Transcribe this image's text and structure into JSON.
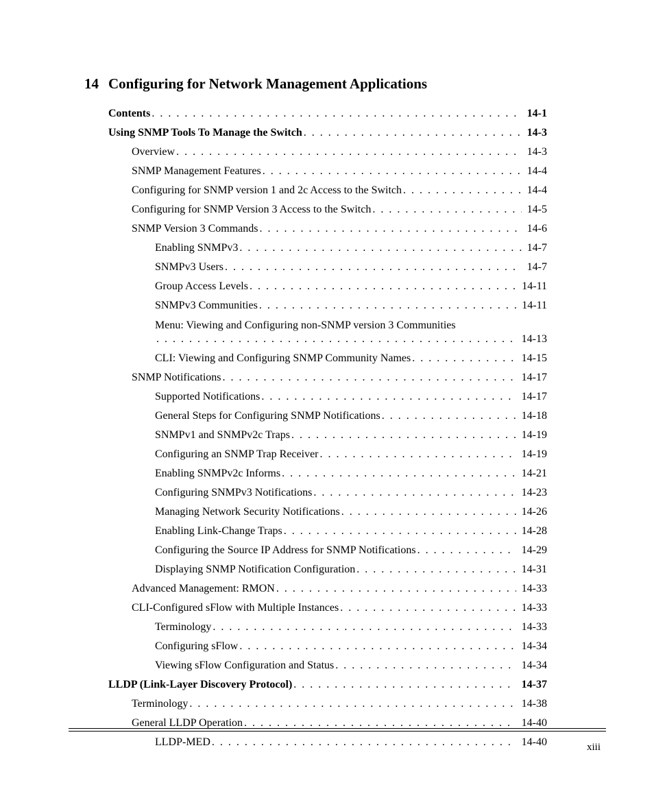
{
  "chapter": {
    "number": "14",
    "title": "Configuring for Network Management Applications"
  },
  "toc": [
    {
      "level": 1,
      "bold": true,
      "label": "Contents",
      "page": "14-1"
    },
    {
      "level": 1,
      "bold": true,
      "label": "Using SNMP Tools To Manage the Switch",
      "page": "14-3"
    },
    {
      "level": 2,
      "bold": false,
      "label": "Overview",
      "page": "14-3"
    },
    {
      "level": 2,
      "bold": false,
      "label": "SNMP Management Features",
      "page": "14-4"
    },
    {
      "level": 2,
      "bold": false,
      "label": "Configuring for SNMP version 1 and 2c Access to the Switch",
      "page": "14-4"
    },
    {
      "level": 2,
      "bold": false,
      "label": "Configuring for SNMP Version 3 Access to the Switch",
      "page": "14-5"
    },
    {
      "level": 2,
      "bold": false,
      "label": "SNMP Version 3 Commands",
      "page": "14-6"
    },
    {
      "level": 3,
      "bold": false,
      "label": "Enabling SNMPv3",
      "page": "14-7"
    },
    {
      "level": 3,
      "bold": false,
      "label": "SNMPv3 Users",
      "page": "14-7"
    },
    {
      "level": 3,
      "bold": false,
      "label": "Group Access Levels",
      "page": "14-11"
    },
    {
      "level": 3,
      "bold": false,
      "label": "SNMPv3 Communities",
      "page": "14-11"
    },
    {
      "level": 3,
      "bold": false,
      "wrap": true,
      "label": "Menu: Viewing and Configuring non-SNMP version 3 Communities",
      "page": "14-13"
    },
    {
      "level": 3,
      "bold": false,
      "label": "CLI: Viewing and Configuring SNMP Community Names",
      "page": "14-15"
    },
    {
      "level": 2,
      "bold": false,
      "label": "SNMP Notifications",
      "page": "14-17"
    },
    {
      "level": 3,
      "bold": false,
      "label": "Supported Notifications",
      "page": "14-17"
    },
    {
      "level": 3,
      "bold": false,
      "label": "General Steps for Configuring SNMP Notifications",
      "page": "14-18"
    },
    {
      "level": 3,
      "bold": false,
      "label": "SNMPv1 and SNMPv2c Traps",
      "page": "14-19"
    },
    {
      "level": 3,
      "bold": false,
      "label": "Configuring an SNMP Trap Receiver",
      "page": "14-19"
    },
    {
      "level": 3,
      "bold": false,
      "label": "Enabling SNMPv2c Informs",
      "page": "14-21"
    },
    {
      "level": 3,
      "bold": false,
      "label": "Configuring SNMPv3 Notifications",
      "page": "14-23"
    },
    {
      "level": 3,
      "bold": false,
      "label": "Managing Network Security Notifications",
      "page": "14-26"
    },
    {
      "level": 3,
      "bold": false,
      "label": "Enabling Link-Change Traps",
      "page": "14-28"
    },
    {
      "level": 3,
      "bold": false,
      "label": "Configuring the Source IP Address for SNMP Notifications",
      "page": "14-29"
    },
    {
      "level": 3,
      "bold": false,
      "label": "Displaying SNMP Notification Configuration",
      "page": "14-31"
    },
    {
      "level": 2,
      "bold": false,
      "label": "Advanced Management: RMON",
      "page": "14-33"
    },
    {
      "level": 2,
      "bold": false,
      "label": "CLI-Configured sFlow with Multiple Instances",
      "page": "14-33"
    },
    {
      "level": 3,
      "bold": false,
      "label": "Terminology",
      "page": "14-33"
    },
    {
      "level": 3,
      "bold": false,
      "label": "Configuring sFlow",
      "page": "14-34"
    },
    {
      "level": 3,
      "bold": false,
      "label": "Viewing sFlow Configuration and Status",
      "page": "14-34"
    },
    {
      "level": 1,
      "bold": true,
      "label": "LLDP (Link-Layer Discovery Protocol)",
      "page": "14-37"
    },
    {
      "level": 2,
      "bold": false,
      "label": "Terminology",
      "page": "14-38"
    },
    {
      "level": 2,
      "bold": false,
      "label": "General LLDP Operation",
      "page": "14-40"
    },
    {
      "level": 3,
      "bold": false,
      "label": "LLDP-MED",
      "page": "14-40"
    }
  ],
  "folio": "xiii"
}
